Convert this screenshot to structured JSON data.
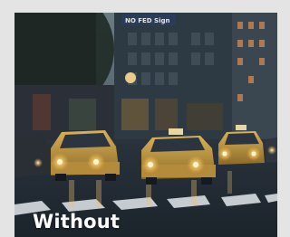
{
  "caption": "Without",
  "signage": {
    "building_sign": "NO FED Sign"
  },
  "scene": {
    "subject": "taxi-cabs-street-dusk",
    "colors": {
      "sky_top": "#5b6d78",
      "building_dark": "#26333d",
      "road": "#232c35",
      "taxi_yellow": "#c9a23c",
      "headlight": "#fff3c8",
      "frame": "#e4e4e4"
    }
  }
}
